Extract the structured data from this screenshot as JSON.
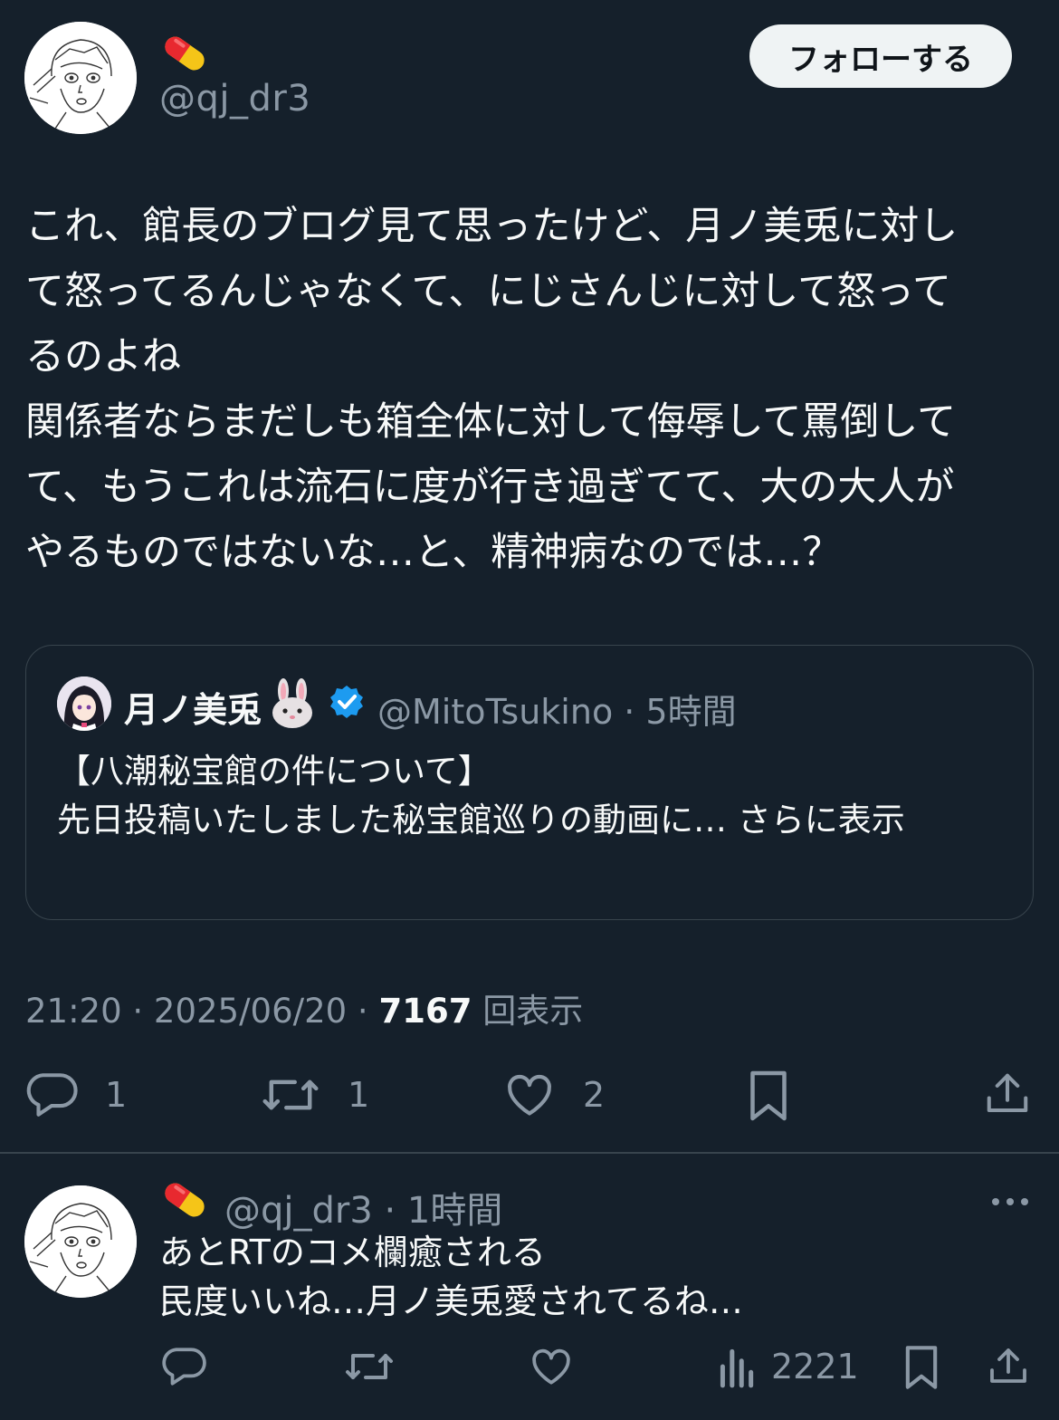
{
  "main_tweet": {
    "handle": "@qj_dr3",
    "follow_label": "フォローする",
    "text_lines": [
      "これ、館長のブログ見て思ったけど、月ノ美兎に対し",
      "て怒ってるんじゃなくて、にじさんじに対して怒って",
      "るのよね",
      "関係者ならまだしも箱全体に対して侮辱して罵倒して",
      "て、もうこれは流石に度が行き過ぎてて、大の大人が",
      "やるものではないな…と、精神病なのでは…？"
    ],
    "timestamp": "21:20 · 2025/06/20 ·",
    "views_count": "7167",
    "views_label": "回表示",
    "reply_count": "1",
    "retweet_count": "1",
    "like_count": "2"
  },
  "quote": {
    "name": "月ノ美兎",
    "meta": "@MitoTsukino · 5時間",
    "text_lines": [
      "【八潮秘宝館の件について】",
      "先日投稿いたしました秘宝館巡りの動画に… さらに表示"
    ]
  },
  "reply_tweet": {
    "meta": "@qj_dr3 · 1時間",
    "text_lines": [
      "あとRTのコメ欄癒される",
      "民度いいね…月ノ美兎愛されてるね…"
    ],
    "views_count": "2221"
  },
  "colors": {
    "background": "#15202b",
    "text_primary": "#f7f9f9",
    "text_secondary": "#8b98a5",
    "border": "#38444d",
    "verified": "#1d9bf0",
    "follow_button_bg": "#eff3f4"
  },
  "icons": [
    "pill-emoji",
    "rabbit-emoji",
    "verified-badge",
    "reply-icon",
    "retweet-icon",
    "like-icon",
    "bookmark-icon",
    "share-icon",
    "views-icon",
    "more-icon"
  ]
}
